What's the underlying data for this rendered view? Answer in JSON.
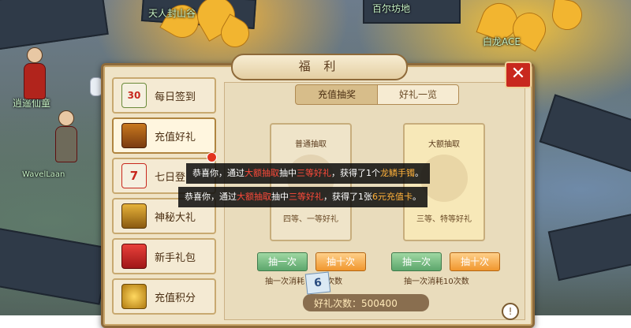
{
  "scene": {
    "labels": [
      "天人封山谷",
      "百尔坊地",
      "白龙ACE",
      "逍遥仙童",
      "WavelLaan"
    ]
  },
  "panel": {
    "title": "福 利",
    "close_symbol": "✕"
  },
  "sidebar": {
    "items": [
      {
        "label": "每日签到",
        "icon": "calendar-30-icon",
        "icon_text": "30"
      },
      {
        "label": "充值好礼",
        "icon": "treasure-chest-icon",
        "icon_text": ""
      },
      {
        "label": "七日登",
        "icon": "calendar-7-icon",
        "icon_text": "7"
      },
      {
        "label": "神秘大礼",
        "icon": "mystery-chest-icon",
        "icon_text": ""
      },
      {
        "label": "新手礼包",
        "icon": "gift-box-icon",
        "icon_text": ""
      },
      {
        "label": "充值积分",
        "icon": "gold-coins-icon",
        "icon_text": ""
      }
    ]
  },
  "tabs": {
    "active": "充值抽奖",
    "inactive": "好礼一览"
  },
  "cards": {
    "normal": {
      "title": "普通抽取",
      "footer": "四等、一等好礼"
    },
    "premium": {
      "title": "大额抽取",
      "footer": "三等、特等好礼"
    }
  },
  "buttons": {
    "normal_once": "抽一次",
    "normal_ten": "抽十次",
    "premium_once": "抽一次",
    "premium_ten": "抽十次"
  },
  "costs": {
    "normal": "抽一次消耗",
    "normal_suffix": "次数",
    "premium": "抽一次消耗10次数"
  },
  "messages": [
    {
      "prefix": "恭喜你，通过",
      "source": "大额抽取",
      "mid": "抽中",
      "grade": "三等好礼",
      "tail": "，获得了1个",
      "prize": "龙鳞手镯",
      "end": "。"
    },
    {
      "prefix": "恭喜你，通过",
      "source": "大额抽取",
      "mid": "抽中",
      "grade": "三等好礼",
      "tail": "，获得了1张",
      "prize": "6元充值卡",
      "end": "。"
    }
  ],
  "footer": {
    "badge": "6",
    "gift_count_label": "好礼次数：",
    "gift_count_value": "500400",
    "info": "!"
  }
}
